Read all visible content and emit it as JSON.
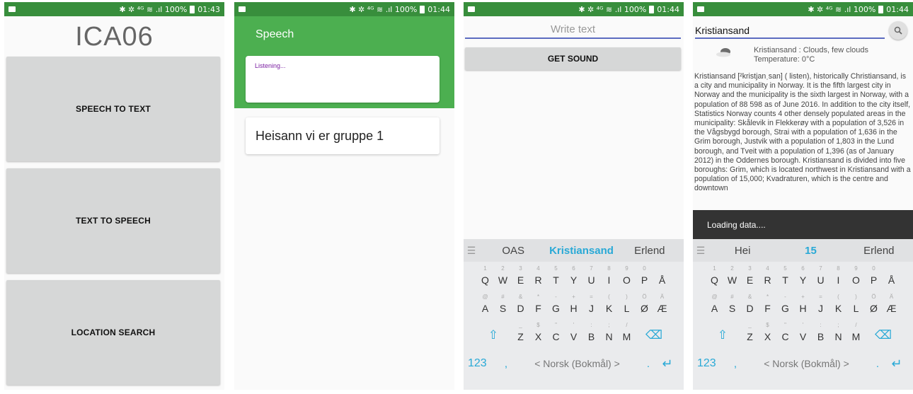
{
  "statusbar": {
    "time1": "01:43",
    "time2": "01:44",
    "time3": "01:44",
    "time4": "01:44",
    "right": "✱ ✲ ⁴ᴳ ≋ .ıl 100%"
  },
  "screen1": {
    "title": "ICA06",
    "buttons": [
      "SPEECH TO TEXT",
      "TEXT TO SPEECH",
      "LOCATION SEARCH"
    ]
  },
  "screen2": {
    "title": "Speech",
    "listening": "Listening...",
    "result": "Heisann vi er gruppe 1"
  },
  "screen3": {
    "placeholder": "Write text",
    "button": "GET SOUND",
    "suggestions": [
      "OAS",
      "Kristiansand",
      "Erlend"
    ]
  },
  "screen4": {
    "query": "Kristiansand",
    "weather_line1": "Kristiansand : Clouds, few clouds",
    "weather_line2": "Temperature: 0°C",
    "article": "Kristiansand [²kristjanˌsan] ( listen), historically Christiansand, is a city and municipality in Norway. It is the fifth largest city in Norway and the municipality is the sixth largest in Norway, with a population of 88 598 as of June 2016. In addition to the city itself, Statistics Norway counts 4 other densely populated areas in the municipality: Skålevik in Flekkerøy with a population of 3,526 in the Vågsbygd borough, Strai with a population of 1,636 in the Grim borough, Justvik with a population of 1,803 in the Lund borough, and Tveit with a population of 1,396 (as of January 2012) in the Oddernes borough. Kristiansand is divided into five boroughs: Grim, which is located northwest in Kristiansand with a population of 15,000; Kvadraturen, which is the centre and downtown",
    "toast": "Loading data....",
    "suggestions": [
      "Hei",
      "15",
      "Erlend"
    ]
  },
  "keyboard": {
    "row1": [
      "Q",
      "W",
      "E",
      "R",
      "T",
      "Y",
      "U",
      "I",
      "O",
      "P",
      "Å"
    ],
    "row1_hints": [
      "1",
      "2",
      "3",
      "4",
      "5",
      "6",
      "7",
      "8",
      "9",
      "0",
      ""
    ],
    "row2": [
      "A",
      "S",
      "D",
      "F",
      "G",
      "H",
      "J",
      "K",
      "L",
      "Ø",
      "Æ"
    ],
    "row2_hints": [
      "@",
      "#",
      "&",
      "*",
      "-",
      "+",
      "=",
      "(",
      ")",
      "Ö",
      "Ä"
    ],
    "row3": [
      "Z",
      "X",
      "C",
      "V",
      "B",
      "N",
      "M"
    ],
    "row3_hints": [
      "_",
      "$",
      "\"",
      "'",
      ":",
      ";",
      "/"
    ],
    "mode": "123",
    "comma": ",",
    "space": "< Norsk (Bokmål) >",
    "period": "."
  }
}
